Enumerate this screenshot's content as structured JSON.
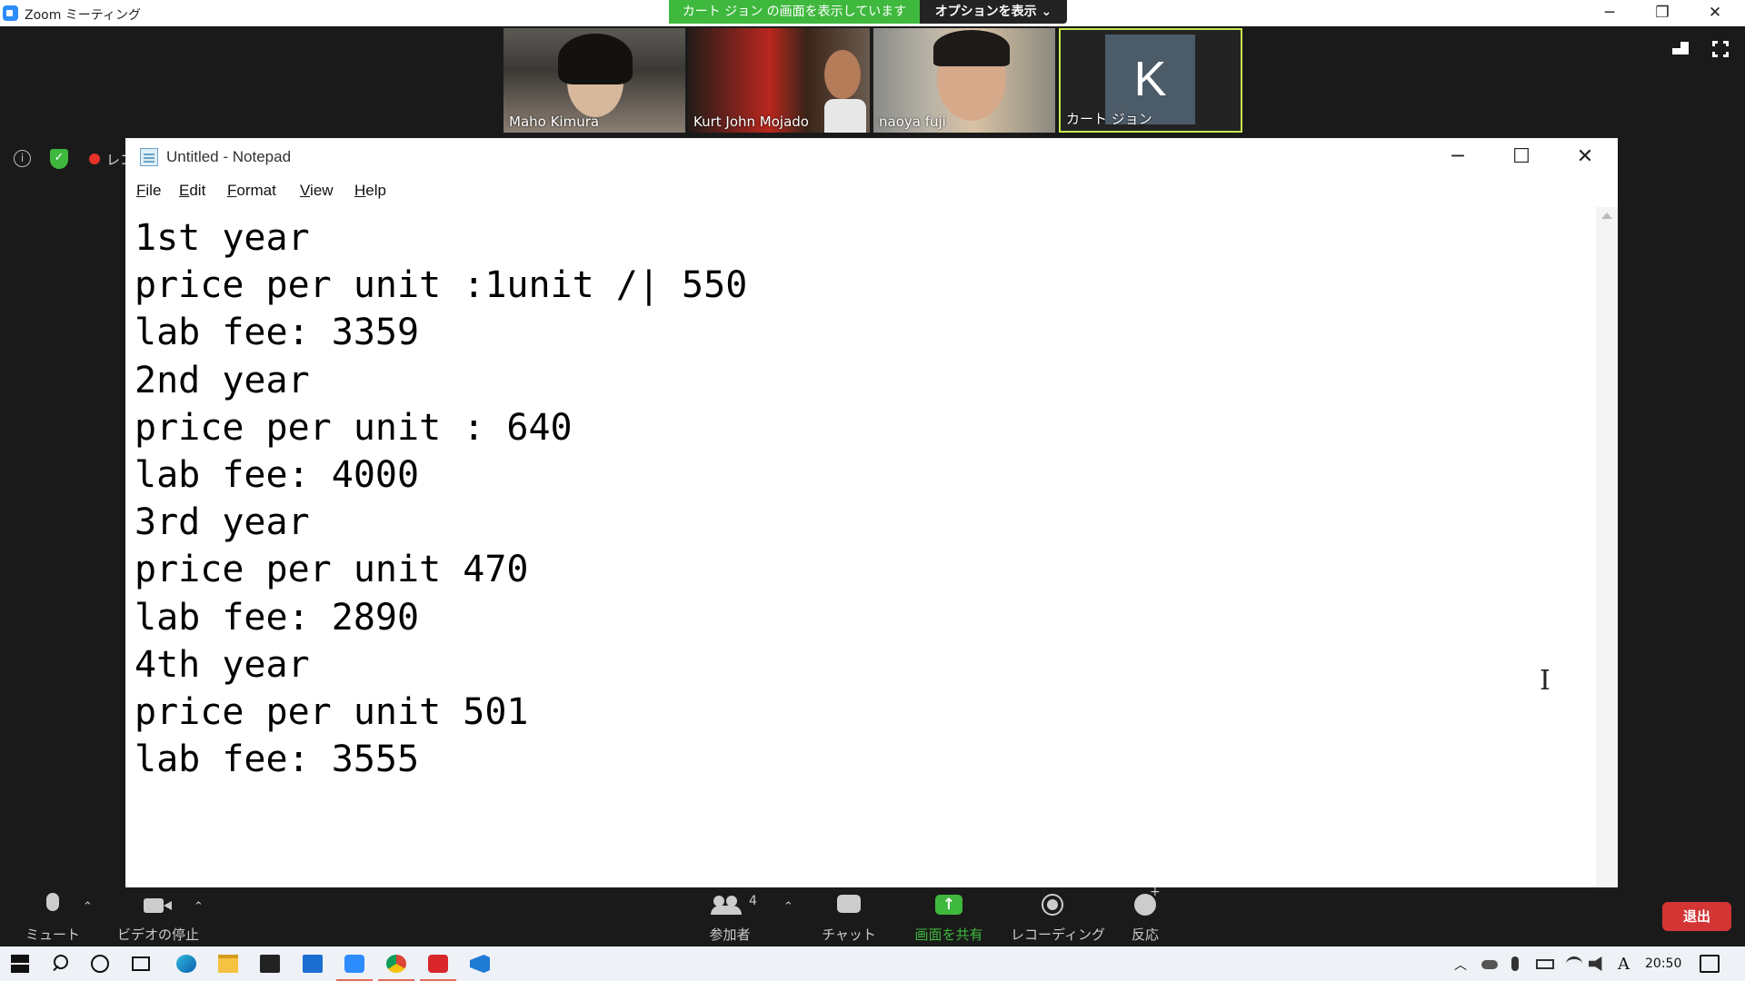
{
  "zoom": {
    "window_title": "Zoom ミーティング",
    "share_banner": "カート ジョン の画面を表示しています",
    "options_button": "オプションを表示 ⌄",
    "participants": [
      {
        "name": "Maho Kimura"
      },
      {
        "name": "Kurt John Mojado"
      },
      {
        "name": "naoya fuji"
      },
      {
        "name": "カート ジョン",
        "avatar_letter": "K"
      }
    ],
    "recording_label": "レコ",
    "toolbar": {
      "mute": "ミュート",
      "stop_video": "ビデオの停止",
      "participants": "参加者",
      "participant_count": "4",
      "chat": "チャット",
      "share_screen": "画面を共有",
      "recording": "レコーディング",
      "reactions": "反応",
      "leave": "退出"
    },
    "colors": {
      "share_green": "#3fb83e",
      "leave_red": "#d33534",
      "active_speaker": "#c7e94a"
    }
  },
  "notepad": {
    "title": "Untitled - Notepad",
    "menu": [
      "File",
      "Edit",
      "Format",
      "View",
      "Help"
    ],
    "lines": [
      "1st year",
      "price per unit :1unit /| 550",
      "lab fee: 3359",
      "2nd year",
      "price per unit : 640",
      "lab fee: 4000",
      "3rd year",
      "price per unit 470",
      "lab fee: 2890",
      "4th year",
      "price per unit 501",
      "lab fee: 3555"
    ]
  },
  "taskbar": {
    "clock": "20:50",
    "ime": "A",
    "icons": [
      "windows-start-icon",
      "search-icon",
      "cortana-icon",
      "task-view-icon",
      "edge-icon",
      "file-explorer-icon",
      "store-icon",
      "mail-icon",
      "zoom-icon",
      "chrome-icon",
      "app-icon",
      "vscode-icon"
    ]
  }
}
